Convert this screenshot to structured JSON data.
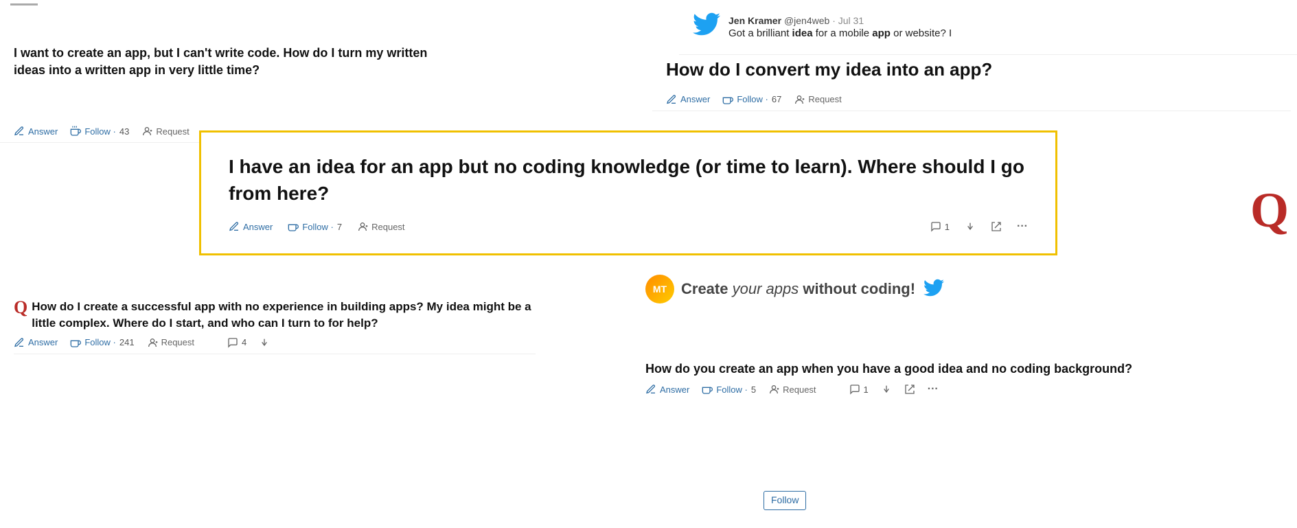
{
  "twitter_top": {
    "user_name": "Jen Kramer",
    "handle": "@jen4web",
    "date": "· Jul 31",
    "tweet_text": "Got a brilliant idea for a mobile app or website? I"
  },
  "question_top_left": {
    "title": "I want to create an app, but I can't write code. How do I turn my written ideas into a written app in very little time?",
    "answer_label": "Answer",
    "follow_label": "Follow",
    "follow_count": "43",
    "request_label": "Request"
  },
  "question_highlighted": {
    "title": "I have an idea for an app but no coding knowledge (or time to learn). Where should I go from here?",
    "answer_label": "Answer",
    "follow_label": "Follow",
    "follow_count": "7",
    "request_label": "Request",
    "comment_count": "1"
  },
  "question_right_top": {
    "title": "How do I convert my idea into an app?",
    "answer_label": "Answer",
    "follow_label": "Follow",
    "follow_count": "67",
    "request_label": "Request"
  },
  "question_second_left": {
    "title": "How do I create a successful app with no experience in building apps? My idea might be a little complex. Where do I start, and who can I turn to for help?",
    "answer_label": "Answer",
    "follow_label": "Follow",
    "follow_count": "241",
    "request_label": "Request",
    "comment_count": "4"
  },
  "mobile_tools_banner": {
    "text_plain": "Create",
    "text_italic": "your apps",
    "text_bold": "without coding!"
  },
  "question_bottom_right": {
    "title": "How do you create an app when you have a good idea and no coding background?",
    "answer_label": "Answer",
    "follow_label": "Follow",
    "follow_count": "5",
    "request_label": "Request",
    "comment_count": "1"
  },
  "icons": {
    "answer": "✏",
    "follow": ")",
    "request": "→",
    "comment": "○",
    "downvote": "▽",
    "share": "↗",
    "more": "···"
  },
  "colors": {
    "twitter_blue": "#1da1f2",
    "quora_red": "#b92b27",
    "highlight_border": "#f0c000",
    "action_blue": "#2e6da4",
    "text_dark": "#111111",
    "text_gray": "#666666"
  }
}
